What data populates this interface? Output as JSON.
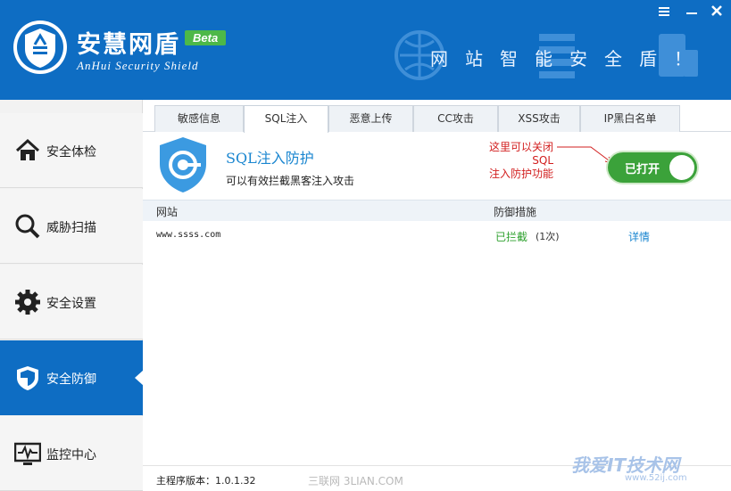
{
  "header": {
    "app_name": "安慧网盾",
    "beta": "Beta",
    "app_name_en": "AnHui Security Shield",
    "slogan": "网站智能安全盾！",
    "menu_icon": "menu-icon",
    "close_icon": "close-icon",
    "bg_color": "#0e6dc3"
  },
  "sidebar": {
    "items": [
      {
        "label": "安全体检",
        "icon": "home-icon"
      },
      {
        "label": "威胁扫描",
        "icon": "magnifier-icon"
      },
      {
        "label": "安全设置",
        "icon": "gear-icon"
      },
      {
        "label": "安全防御",
        "icon": "shield-icon",
        "active": true
      },
      {
        "label": "监控中心",
        "icon": "monitor-icon"
      }
    ]
  },
  "tabs": [
    {
      "label": "敏感信息"
    },
    {
      "label": "SQL注入",
      "active": true
    },
    {
      "label": "恶意上传"
    },
    {
      "label": "CC攻击"
    },
    {
      "label": "XSS攻击"
    },
    {
      "label": "IP黑白名单"
    }
  ],
  "feature": {
    "title": "SQL注入防护",
    "description": "可以有效拦截黑客注入攻击",
    "toggle_label": "已打开",
    "toggle_on": true,
    "annotation_line1": "这里可以关闭SQL",
    "annotation_line2": "注入防护功能"
  },
  "table": {
    "columns": [
      "网站",
      "防御措施"
    ],
    "rows": [
      {
        "site": "www.ssss.com",
        "status": "已拦截",
        "count": "(1次)",
        "action": "详情"
      }
    ]
  },
  "footer": {
    "version": "主程序版本：1.0.1.32"
  },
  "watermarks": {
    "left": "三联网 3LIAN.COM",
    "right": "我爱IT技术网",
    "right_url": "www.52ij.com"
  }
}
